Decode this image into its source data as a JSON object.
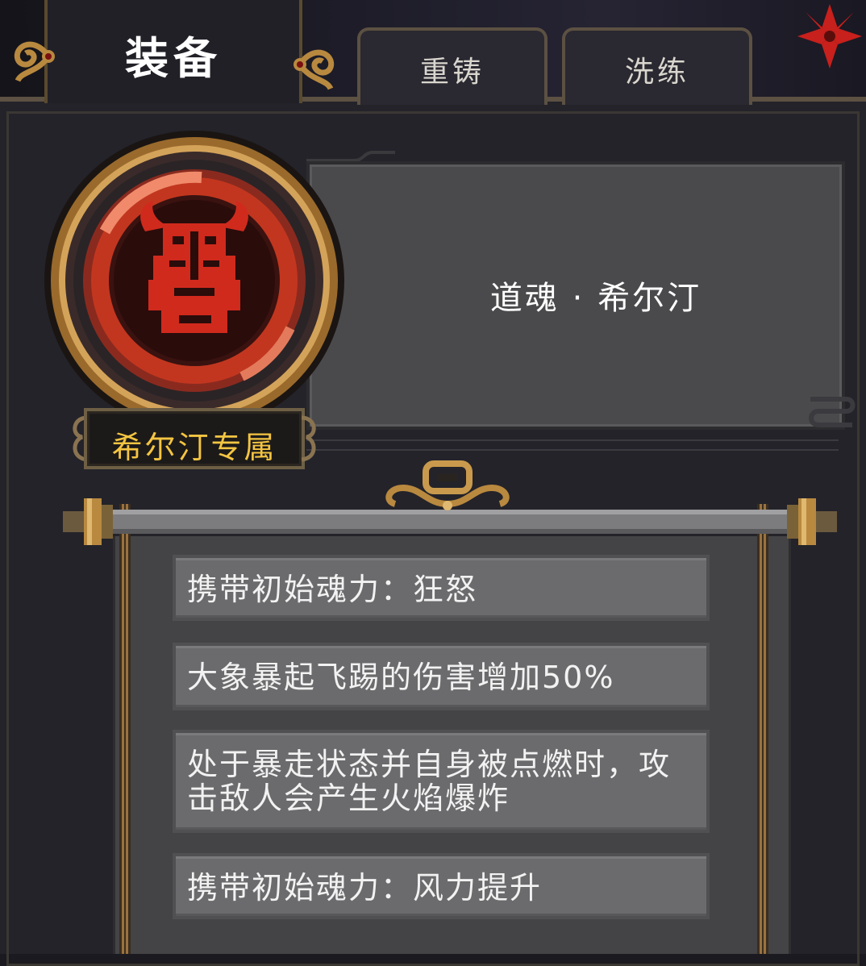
{
  "tabs": {
    "equip": "装备",
    "reforge": "重铸",
    "refine": "洗练"
  },
  "item": {
    "name": "道魂 · 希尔汀",
    "exclusive_label": "希尔汀专属",
    "icon": "horned-demon-mask-icon"
  },
  "effects": [
    "携带初始魂力：狂怒",
    "大象暴起飞踢的伤害增加50%",
    "处于暴走状态并自身被点燃时，攻击敌人会产生火焰爆炸",
    "携带初始魂力：风力提升"
  ],
  "colors": {
    "panel": "#24232a",
    "name_plate": "#4a4a4c",
    "effect_row": "#6b6b6d",
    "badge_text": "#f4c542",
    "gold_trim": "#b8893f",
    "medallion_red": "#c2361f"
  }
}
